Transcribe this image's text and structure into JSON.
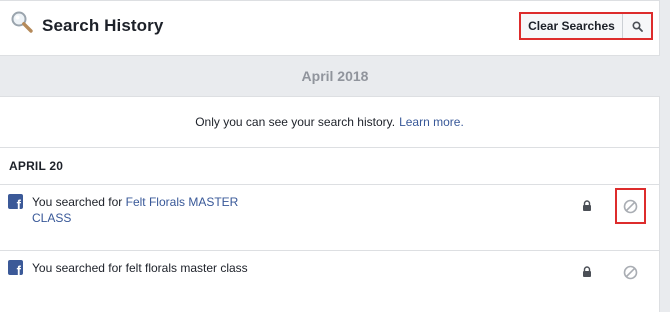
{
  "header": {
    "title": "Search History",
    "clear_label": "Clear Searches",
    "icons": {
      "page": "magnifier-icon",
      "search": "search-icon"
    }
  },
  "month": {
    "label": "April 2018"
  },
  "notice": {
    "text": "Only you can see your search history.",
    "link": "Learn more."
  },
  "day": {
    "label": "APRIL 20"
  },
  "entries": [
    {
      "prefix": "You searched for",
      "query": "Felt Florals MASTER CLASS",
      "query_is_link": true,
      "source_icon": "facebook-icon",
      "privacy_icon": "lock-icon",
      "action_icon": "remove-icon"
    },
    {
      "prefix": "You searched for",
      "query": "felt florals master class",
      "query_is_link": false,
      "source_icon": "facebook-icon",
      "privacy_icon": "lock-icon",
      "action_icon": "remove-icon"
    }
  ],
  "colors": {
    "background": "#e9ebee",
    "link": "#385898",
    "facebook": "#3b5998",
    "highlight": "#dd2c2c",
    "muted": "#90949c"
  }
}
